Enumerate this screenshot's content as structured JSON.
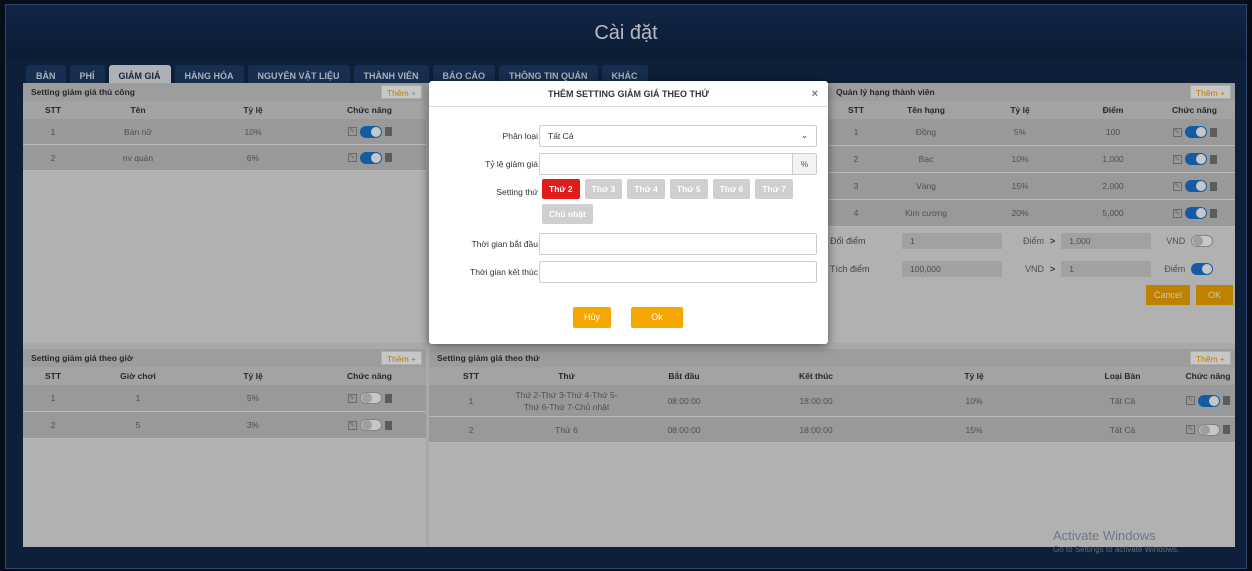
{
  "window_title": "Cài đặt",
  "tabs": [
    "BÀN",
    "PHÍ",
    "GIẢM GIÁ",
    "HÀNG HÓA",
    "NGUYÊN VẬT LIỆU",
    "THÀNH VIÊN",
    "BÁO CÁO",
    "THÔNG TIN QUÁN",
    "KHÁC"
  ],
  "manual": {
    "title": "Setting giảm giá thủ công",
    "add": "Thêm +",
    "headers": [
      "STT",
      "Tên",
      "Tỷ lệ",
      "Chức năng"
    ],
    "rows": [
      {
        "stt": "1",
        "name": "Bàn nữ",
        "rate": "10%",
        "on": true
      },
      {
        "stt": "2",
        "name": "nv quán",
        "rate": "6%",
        "on": true
      }
    ]
  },
  "members": {
    "title": "Quản lý hạng thành viên",
    "add": "Thêm +",
    "headers": [
      "STT",
      "Tên hạng",
      "Tỷ lệ",
      "Điểm",
      "Chức năng"
    ],
    "rows": [
      {
        "stt": "1",
        "name": "Đồng",
        "rate": "5%",
        "points": "100",
        "on": true
      },
      {
        "stt": "2",
        "name": "Bạc",
        "rate": "10%",
        "points": "1,000",
        "on": true
      },
      {
        "stt": "3",
        "name": "Vàng",
        "rate": "15%",
        "points": "2,000",
        "on": true
      },
      {
        "stt": "4",
        "name": "Kim cương",
        "rate": "20%",
        "points": "5,000",
        "on": true
      }
    ],
    "exchange": {
      "label": "Đổi điểm",
      "a": "1",
      "ua": "Điểm",
      "b": "1,000",
      "ub": "VND",
      "on": false
    },
    "accumulate": {
      "label": "Tích điểm",
      "a": "100,000",
      "ua": "VND",
      "b": "1",
      "ub": "Điểm",
      "on": true
    },
    "cancel": "Cancel",
    "ok": "OK",
    "arrow": ">"
  },
  "hourly": {
    "title": "Setting giảm giá theo giờ",
    "add": "Thêm +",
    "headers": [
      "STT",
      "Giờ chơi",
      "Tỷ lệ",
      "Chức năng"
    ],
    "rows": [
      {
        "stt": "1",
        "hours": "1",
        "rate": "5%",
        "on": false
      },
      {
        "stt": "2",
        "hours": "5",
        "rate": "3%",
        "on": false
      }
    ]
  },
  "weekday": {
    "title": "Setting giảm giá theo thứ",
    "add": "Thêm +",
    "headers": [
      "STT",
      "Thứ",
      "Bắt đầu",
      "Kết thúc",
      "Tỷ lệ",
      "Loại Bàn",
      "Chức năng"
    ],
    "rows": [
      {
        "stt": "1",
        "days": "Thứ 2-Thứ 3-Thứ 4-Thứ 5-Thứ 6-Thứ 7-Chủ nhật",
        "start": "08:00:00",
        "end": "18:00:00",
        "rate": "10%",
        "type": "Tất Cả",
        "on": true
      },
      {
        "stt": "2",
        "days": "Thứ 6",
        "start": "08:00:00",
        "end": "18:00:00",
        "rate": "15%",
        "type": "Tất Cả",
        "on": false
      }
    ]
  },
  "modal": {
    "title": "THÊM SETTING GIẢM GIÁ THEO THỨ",
    "close": "×",
    "category_label": "Phân loại",
    "category_value": "Tất Cả",
    "rate_label": "Tỷ lệ giảm giá",
    "rate_unit": "%",
    "days_label": "Setting thứ",
    "days": [
      "Thứ 2",
      "Thứ 3",
      "Thứ 4",
      "Thứ 5",
      "Thứ 6",
      "Thứ 7",
      "Chủ nhật"
    ],
    "selected_day": "Thứ 2",
    "start_label": "Thời gian bắt đầu",
    "end_label": "Thời gian kết thúc",
    "cancel": "Hủy",
    "ok": "Ok"
  },
  "watermark": {
    "line1": "Activate Windows",
    "line2": "Go to Settings to activate Windows."
  }
}
